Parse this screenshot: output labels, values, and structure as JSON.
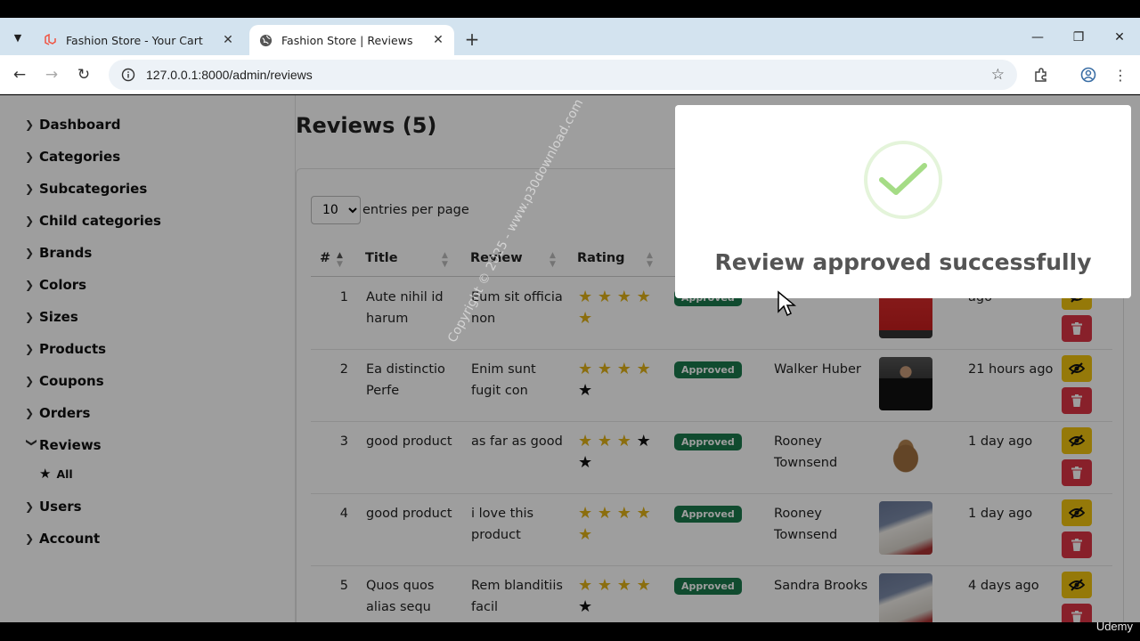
{
  "browser": {
    "tabs": [
      {
        "title": "Fashion Store - Your Cart"
      },
      {
        "title": "Fashion Store | Reviews"
      }
    ],
    "url": "127.0.0.1:8000/admin/reviews"
  },
  "sidebar": {
    "items": [
      {
        "label": "Dashboard"
      },
      {
        "label": "Categories"
      },
      {
        "label": "Subcategories"
      },
      {
        "label": "Child categories"
      },
      {
        "label": "Brands"
      },
      {
        "label": "Colors"
      },
      {
        "label": "Sizes"
      },
      {
        "label": "Products"
      },
      {
        "label": "Coupons"
      },
      {
        "label": "Orders"
      },
      {
        "label": "Reviews"
      },
      {
        "label": "Users"
      },
      {
        "label": "Account"
      }
    ],
    "reviews_sub": "All"
  },
  "main": {
    "title": "Reviews (5)",
    "entries_value": "10",
    "entries_label": "entries per page",
    "columns": [
      "#",
      "Title",
      "Review",
      "Rating"
    ],
    "rows": [
      {
        "num": "1",
        "title": "Aute nihil id harum",
        "review": "Eum sit officia non",
        "rating": 5,
        "status": "Approved",
        "user": "",
        "date": "ago"
      },
      {
        "num": "2",
        "title": "Ea distinctio Perfe",
        "review": "Enim sunt fugit con",
        "rating": 4,
        "status": "Approved",
        "user": "Walker Huber",
        "date": "21 hours ago"
      },
      {
        "num": "3",
        "title": "good product",
        "review": "as far as good",
        "rating": 3,
        "status": "Approved",
        "user": "Rooney Townsend",
        "date": "1 day ago"
      },
      {
        "num": "4",
        "title": "good product",
        "review": "i love this product",
        "rating": 5,
        "status": "Approved",
        "user": "Rooney Townsend",
        "date": "1 day ago"
      },
      {
        "num": "5",
        "title": "Quos quos alias sequ",
        "review": "Rem blanditiis facil",
        "rating": 4,
        "status": "Approved",
        "user": "Sandra Brooks",
        "date": "4 days ago"
      }
    ]
  },
  "popup": {
    "message": "Review approved successfully"
  },
  "watermark": "Copyright © 2025 - www.p30download.com",
  "brand_overlay": "Udemy",
  "colors": {
    "star": "#e0b218",
    "badge": "#1b7a4c",
    "hide_button": "#f1c40f",
    "delete_button": "#dc3545",
    "success": "#a5dc86"
  }
}
